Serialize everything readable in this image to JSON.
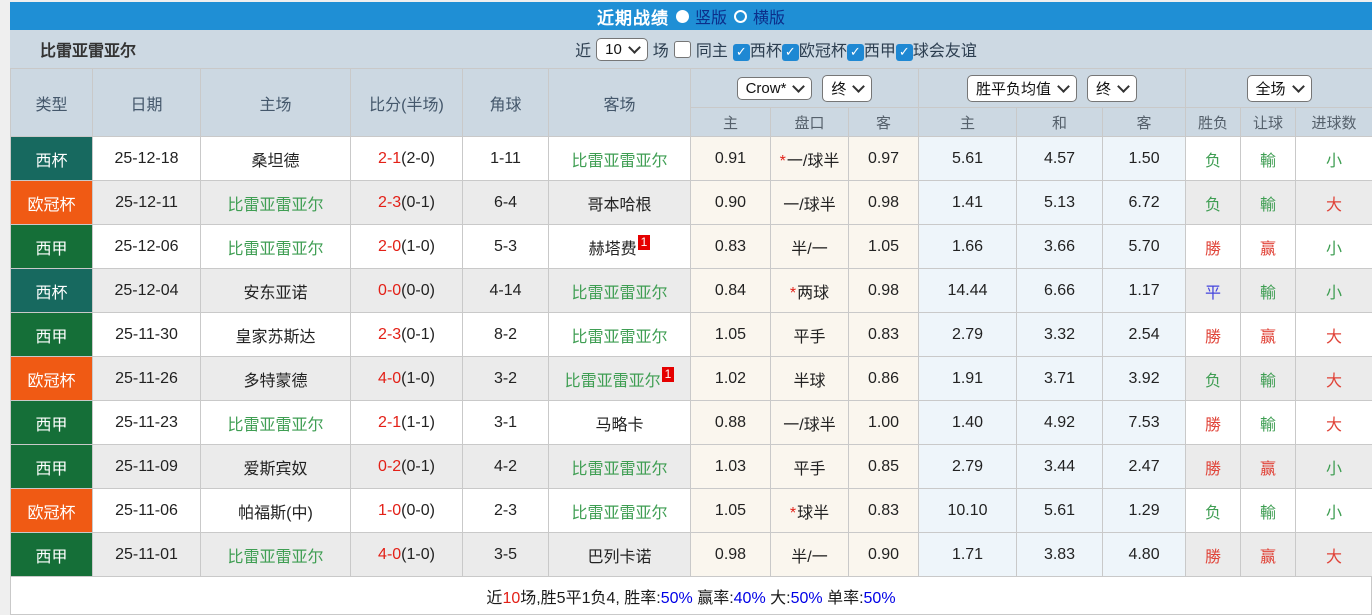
{
  "topbar": {
    "title": "近期战绩",
    "radio_selected_label": "竖版",
    "radio_unselected_label": "横版"
  },
  "filters": {
    "team": "比雷亚雷亚尔",
    "near_label": "近",
    "count": "10",
    "games_label": "场",
    "same_home_label": "同主",
    "same_home_checked": false,
    "leagues": [
      {
        "label": "西杯",
        "checked": true
      },
      {
        "label": "欧冠杯",
        "checked": true
      },
      {
        "label": "西甲",
        "checked": true
      },
      {
        "label": "球会友谊",
        "checked": true
      }
    ]
  },
  "table": {
    "header": {
      "left_cols": [
        "类型",
        "日期",
        "主场",
        "比分(半场)",
        "角球",
        "客场"
      ],
      "group1": {
        "select1": "Crow*",
        "select2": "终",
        "sub": [
          "主",
          "盘口",
          "客"
        ]
      },
      "group2": {
        "select1": "胜平负均值",
        "select2": "终",
        "sub": [
          "主",
          "和",
          "客"
        ]
      },
      "group3": {
        "select1": "全场",
        "sub": [
          "胜负",
          "让球",
          "进球数"
        ]
      }
    },
    "league_colors": {
      "西杯": "#17695f",
      "欧冠杯": "#f05a14",
      "西甲": "#156f38"
    },
    "team_green": "#3f9e53",
    "result_color_map": {
      "勝": "#e04338",
      "负": "#3f9e53",
      "平": "#4444dd",
      "赢": "#e04338",
      "輸": "#3f9e53",
      "大": "#e04338",
      "小": "#3f9e53"
    },
    "rows": [
      {
        "league": "西杯",
        "date": "25-12-18",
        "home": "桑坦德",
        "home_is_team": false,
        "home_card": null,
        "score": "2-1",
        "half": "(2-0)",
        "corners": "1-11",
        "away": "比雷亚雷亚尔",
        "away_is_team": true,
        "away_card": null,
        "odds_home": "0.91",
        "handicap": "一/球半",
        "handicap_star": true,
        "odds_away": "0.97",
        "avg_win": "5.61",
        "avg_draw": "4.57",
        "avg_lose": "1.50",
        "result_wdl": "负",
        "result_handicap": "輸",
        "result_goals": "小"
      },
      {
        "league": "欧冠杯",
        "date": "25-12-11",
        "home": "比雷亚雷亚尔",
        "home_is_team": true,
        "home_card": null,
        "score": "2-3",
        "half": "(0-1)",
        "corners": "6-4",
        "away": "哥本哈根",
        "away_is_team": false,
        "away_card": null,
        "odds_home": "0.90",
        "handicap": "一/球半",
        "handicap_star": false,
        "odds_away": "0.98",
        "avg_win": "1.41",
        "avg_draw": "5.13",
        "avg_lose": "6.72",
        "result_wdl": "负",
        "result_handicap": "輸",
        "result_goals": "大"
      },
      {
        "league": "西甲",
        "date": "25-12-06",
        "home": "比雷亚雷亚尔",
        "home_is_team": true,
        "home_card": null,
        "score": "2-0",
        "half": "(1-0)",
        "corners": "5-3",
        "away": "赫塔费",
        "away_is_team": false,
        "away_card": "1",
        "odds_home": "0.83",
        "handicap": "半/一",
        "handicap_star": false,
        "odds_away": "1.05",
        "avg_win": "1.66",
        "avg_draw": "3.66",
        "avg_lose": "5.70",
        "result_wdl": "勝",
        "result_handicap": "赢",
        "result_goals": "小"
      },
      {
        "league": "西杯",
        "date": "25-12-04",
        "home": "安东亚诺",
        "home_is_team": false,
        "home_card": null,
        "score": "0-0",
        "half": "(0-0)",
        "corners": "4-14",
        "away": "比雷亚雷亚尔",
        "away_is_team": true,
        "away_card": null,
        "odds_home": "0.84",
        "handicap": "两球",
        "handicap_star": true,
        "odds_away": "0.98",
        "avg_win": "14.44",
        "avg_draw": "6.66",
        "avg_lose": "1.17",
        "result_wdl": "平",
        "result_handicap": "輸",
        "result_goals": "小"
      },
      {
        "league": "西甲",
        "date": "25-11-30",
        "home": "皇家苏斯达",
        "home_is_team": false,
        "home_card": null,
        "score": "2-3",
        "half": "(0-1)",
        "corners": "8-2",
        "away": "比雷亚雷亚尔",
        "away_is_team": true,
        "away_card": null,
        "odds_home": "1.05",
        "handicap": "平手",
        "handicap_star": false,
        "odds_away": "0.83",
        "avg_win": "2.79",
        "avg_draw": "3.32",
        "avg_lose": "2.54",
        "result_wdl": "勝",
        "result_handicap": "赢",
        "result_goals": "大"
      },
      {
        "league": "欧冠杯",
        "date": "25-11-26",
        "home": "多特蒙德",
        "home_is_team": false,
        "home_card": null,
        "score": "4-0",
        "half": "(1-0)",
        "corners": "3-2",
        "away": "比雷亚雷亚尔",
        "away_is_team": true,
        "away_card": "1",
        "odds_home": "1.02",
        "handicap": "半球",
        "handicap_star": false,
        "odds_away": "0.86",
        "avg_win": "1.91",
        "avg_draw": "3.71",
        "avg_lose": "3.92",
        "result_wdl": "负",
        "result_handicap": "輸",
        "result_goals": "大"
      },
      {
        "league": "西甲",
        "date": "25-11-23",
        "home": "比雷亚雷亚尔",
        "home_is_team": true,
        "home_card": null,
        "score": "2-1",
        "half": "(1-1)",
        "corners": "3-1",
        "away": "马略卡",
        "away_is_team": false,
        "away_card": null,
        "odds_home": "0.88",
        "handicap": "一/球半",
        "handicap_star": false,
        "odds_away": "1.00",
        "avg_win": "1.40",
        "avg_draw": "4.92",
        "avg_lose": "7.53",
        "result_wdl": "勝",
        "result_handicap": "輸",
        "result_goals": "大"
      },
      {
        "league": "西甲",
        "date": "25-11-09",
        "home": "爱斯宾奴",
        "home_is_team": false,
        "home_card": null,
        "score": "0-2",
        "half": "(0-1)",
        "corners": "4-2",
        "away": "比雷亚雷亚尔",
        "away_is_team": true,
        "away_card": null,
        "odds_home": "1.03",
        "handicap": "平手",
        "handicap_star": false,
        "odds_away": "0.85",
        "avg_win": "2.79",
        "avg_draw": "3.44",
        "avg_lose": "2.47",
        "result_wdl": "勝",
        "result_handicap": "赢",
        "result_goals": "小"
      },
      {
        "league": "欧冠杯",
        "date": "25-11-06",
        "home": "帕福斯(中)",
        "home_is_team": false,
        "home_card": null,
        "score": "1-0",
        "half": "(0-0)",
        "corners": "2-3",
        "away": "比雷亚雷亚尔",
        "away_is_team": true,
        "away_card": null,
        "odds_home": "1.05",
        "handicap": "球半",
        "handicap_star": true,
        "odds_away": "0.83",
        "avg_win": "10.10",
        "avg_draw": "5.61",
        "avg_lose": "1.29",
        "result_wdl": "负",
        "result_handicap": "輸",
        "result_goals": "小"
      },
      {
        "league": "西甲",
        "date": "25-11-01",
        "home": "比雷亚雷亚尔",
        "home_is_team": true,
        "home_card": null,
        "score": "4-0",
        "half": "(1-0)",
        "corners": "3-5",
        "away": "巴列卡诺",
        "away_is_team": false,
        "away_card": null,
        "odds_home": "0.98",
        "handicap": "半/一",
        "handicap_star": false,
        "odds_away": "0.90",
        "avg_win": "1.71",
        "avg_draw": "3.83",
        "avg_lose": "4.80",
        "result_wdl": "勝",
        "result_handicap": "赢",
        "result_goals": "大"
      }
    ]
  },
  "footer": {
    "segments": [
      {
        "text": "近",
        "color": "#1a1a1a"
      },
      {
        "text": "10",
        "color": "#e32017"
      },
      {
        "text": "场,胜5平1负4, 胜率:",
        "color": "#1a1a1a"
      },
      {
        "text": "50%",
        "color": "#0000e6"
      },
      {
        "text": " 赢率:",
        "color": "#1a1a1a"
      },
      {
        "text": "40%",
        "color": "#0000e6"
      },
      {
        "text": " 大:",
        "color": "#1a1a1a"
      },
      {
        "text": "50%",
        "color": "#0000e6"
      },
      {
        "text": " 单率:",
        "color": "#1a1a1a"
      },
      {
        "text": "50%",
        "color": "#0000e6"
      }
    ]
  }
}
